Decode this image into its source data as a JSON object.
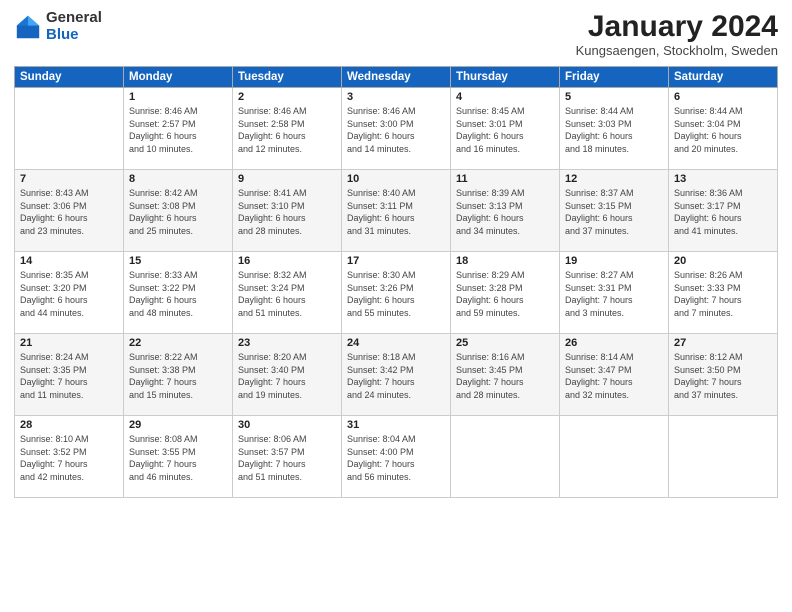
{
  "logo": {
    "general": "General",
    "blue": "Blue"
  },
  "title": "January 2024",
  "location": "Kungsaengen, Stockholm, Sweden",
  "days_of_week": [
    "Sunday",
    "Monday",
    "Tuesday",
    "Wednesday",
    "Thursday",
    "Friday",
    "Saturday"
  ],
  "weeks": [
    [
      {
        "day": "",
        "info": ""
      },
      {
        "day": "1",
        "info": "Sunrise: 8:46 AM\nSunset: 2:57 PM\nDaylight: 6 hours\nand 10 minutes."
      },
      {
        "day": "2",
        "info": "Sunrise: 8:46 AM\nSunset: 2:58 PM\nDaylight: 6 hours\nand 12 minutes."
      },
      {
        "day": "3",
        "info": "Sunrise: 8:46 AM\nSunset: 3:00 PM\nDaylight: 6 hours\nand 14 minutes."
      },
      {
        "day": "4",
        "info": "Sunrise: 8:45 AM\nSunset: 3:01 PM\nDaylight: 6 hours\nand 16 minutes."
      },
      {
        "day": "5",
        "info": "Sunrise: 8:44 AM\nSunset: 3:03 PM\nDaylight: 6 hours\nand 18 minutes."
      },
      {
        "day": "6",
        "info": "Sunrise: 8:44 AM\nSunset: 3:04 PM\nDaylight: 6 hours\nand 20 minutes."
      }
    ],
    [
      {
        "day": "7",
        "info": "Sunrise: 8:43 AM\nSunset: 3:06 PM\nDaylight: 6 hours\nand 23 minutes."
      },
      {
        "day": "8",
        "info": "Sunrise: 8:42 AM\nSunset: 3:08 PM\nDaylight: 6 hours\nand 25 minutes."
      },
      {
        "day": "9",
        "info": "Sunrise: 8:41 AM\nSunset: 3:10 PM\nDaylight: 6 hours\nand 28 minutes."
      },
      {
        "day": "10",
        "info": "Sunrise: 8:40 AM\nSunset: 3:11 PM\nDaylight: 6 hours\nand 31 minutes."
      },
      {
        "day": "11",
        "info": "Sunrise: 8:39 AM\nSunset: 3:13 PM\nDaylight: 6 hours\nand 34 minutes."
      },
      {
        "day": "12",
        "info": "Sunrise: 8:37 AM\nSunset: 3:15 PM\nDaylight: 6 hours\nand 37 minutes."
      },
      {
        "day": "13",
        "info": "Sunrise: 8:36 AM\nSunset: 3:17 PM\nDaylight: 6 hours\nand 41 minutes."
      }
    ],
    [
      {
        "day": "14",
        "info": "Sunrise: 8:35 AM\nSunset: 3:20 PM\nDaylight: 6 hours\nand 44 minutes."
      },
      {
        "day": "15",
        "info": "Sunrise: 8:33 AM\nSunset: 3:22 PM\nDaylight: 6 hours\nand 48 minutes."
      },
      {
        "day": "16",
        "info": "Sunrise: 8:32 AM\nSunset: 3:24 PM\nDaylight: 6 hours\nand 51 minutes."
      },
      {
        "day": "17",
        "info": "Sunrise: 8:30 AM\nSunset: 3:26 PM\nDaylight: 6 hours\nand 55 minutes."
      },
      {
        "day": "18",
        "info": "Sunrise: 8:29 AM\nSunset: 3:28 PM\nDaylight: 6 hours\nand 59 minutes."
      },
      {
        "day": "19",
        "info": "Sunrise: 8:27 AM\nSunset: 3:31 PM\nDaylight: 7 hours\nand 3 minutes."
      },
      {
        "day": "20",
        "info": "Sunrise: 8:26 AM\nSunset: 3:33 PM\nDaylight: 7 hours\nand 7 minutes."
      }
    ],
    [
      {
        "day": "21",
        "info": "Sunrise: 8:24 AM\nSunset: 3:35 PM\nDaylight: 7 hours\nand 11 minutes."
      },
      {
        "day": "22",
        "info": "Sunrise: 8:22 AM\nSunset: 3:38 PM\nDaylight: 7 hours\nand 15 minutes."
      },
      {
        "day": "23",
        "info": "Sunrise: 8:20 AM\nSunset: 3:40 PM\nDaylight: 7 hours\nand 19 minutes."
      },
      {
        "day": "24",
        "info": "Sunrise: 8:18 AM\nSunset: 3:42 PM\nDaylight: 7 hours\nand 24 minutes."
      },
      {
        "day": "25",
        "info": "Sunrise: 8:16 AM\nSunset: 3:45 PM\nDaylight: 7 hours\nand 28 minutes."
      },
      {
        "day": "26",
        "info": "Sunrise: 8:14 AM\nSunset: 3:47 PM\nDaylight: 7 hours\nand 32 minutes."
      },
      {
        "day": "27",
        "info": "Sunrise: 8:12 AM\nSunset: 3:50 PM\nDaylight: 7 hours\nand 37 minutes."
      }
    ],
    [
      {
        "day": "28",
        "info": "Sunrise: 8:10 AM\nSunset: 3:52 PM\nDaylight: 7 hours\nand 42 minutes."
      },
      {
        "day": "29",
        "info": "Sunrise: 8:08 AM\nSunset: 3:55 PM\nDaylight: 7 hours\nand 46 minutes."
      },
      {
        "day": "30",
        "info": "Sunrise: 8:06 AM\nSunset: 3:57 PM\nDaylight: 7 hours\nand 51 minutes."
      },
      {
        "day": "31",
        "info": "Sunrise: 8:04 AM\nSunset: 4:00 PM\nDaylight: 7 hours\nand 56 minutes."
      },
      {
        "day": "",
        "info": ""
      },
      {
        "day": "",
        "info": ""
      },
      {
        "day": "",
        "info": ""
      }
    ]
  ]
}
